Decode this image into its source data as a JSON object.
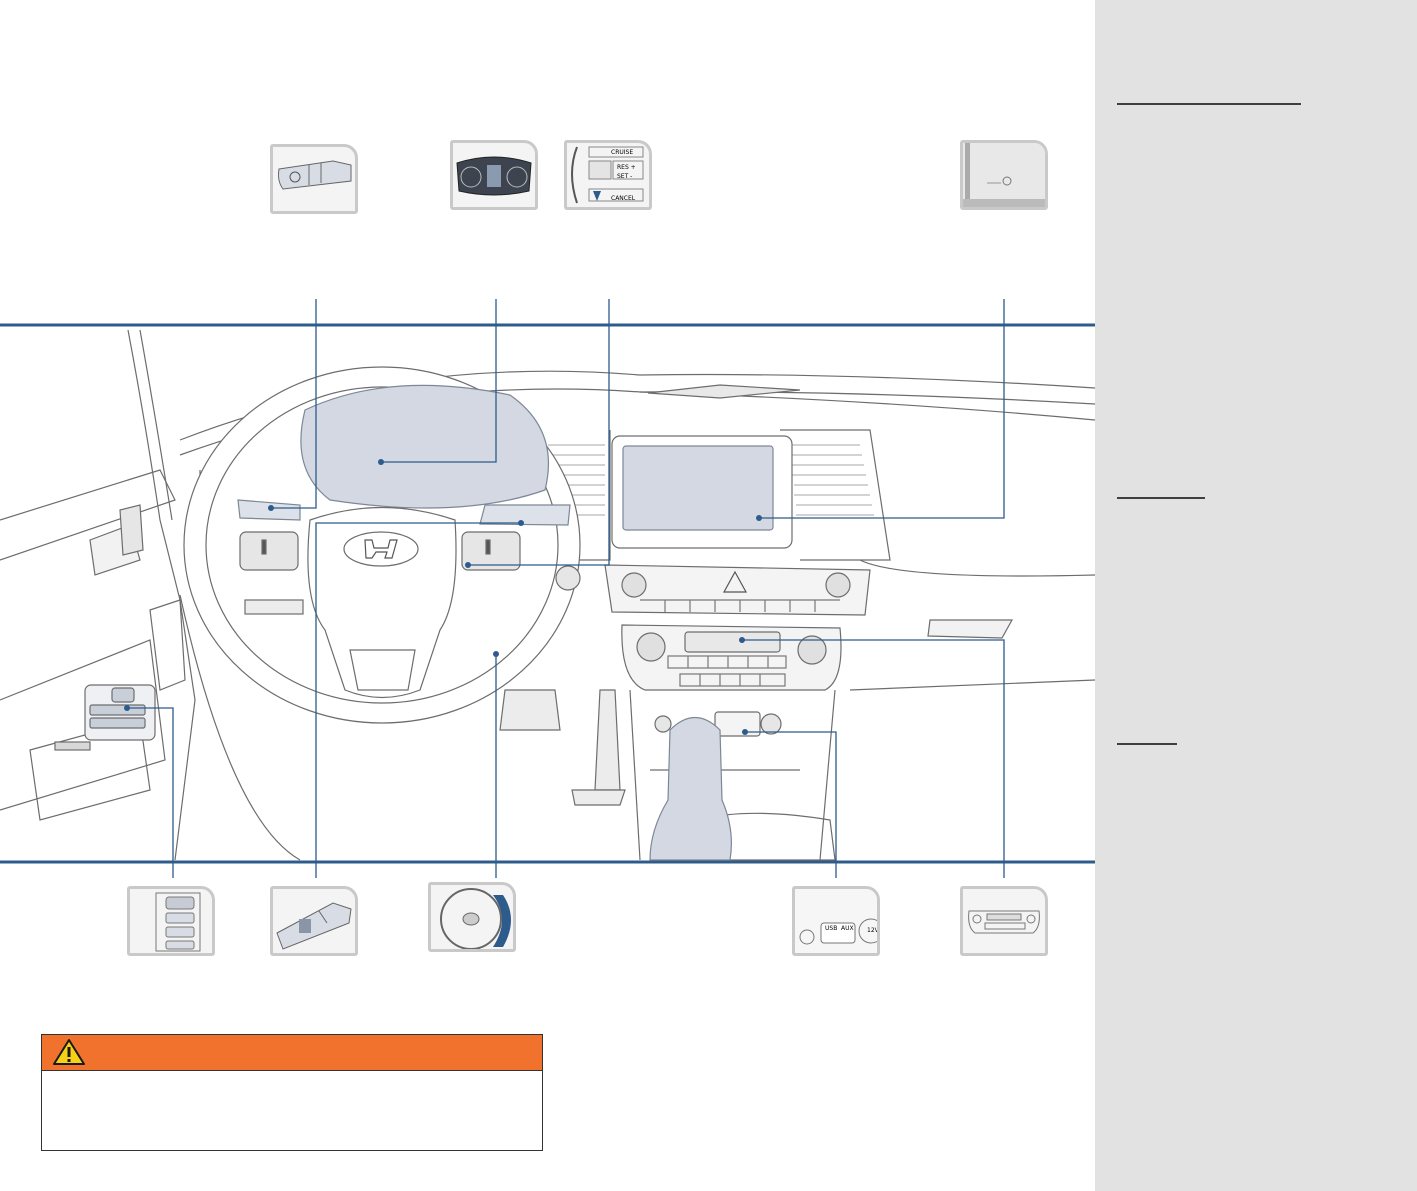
{
  "thumbnails": {
    "cruise_control": {
      "cruise_label": "CRUISE",
      "res_label": "RES +",
      "set_label": "SET -",
      "cancel_label": "CANCEL"
    },
    "center_console": {
      "usb_label": "USB",
      "aux_label": "AUX",
      "power_label": "12V"
    }
  },
  "colors": {
    "accent_blue": "#2d5b8c",
    "warning_orange": "#f0722c",
    "sidebar_gray": "#e2e2e2"
  },
  "warning": {
    "icon": "warning-triangle-icon",
    "text": ""
  }
}
